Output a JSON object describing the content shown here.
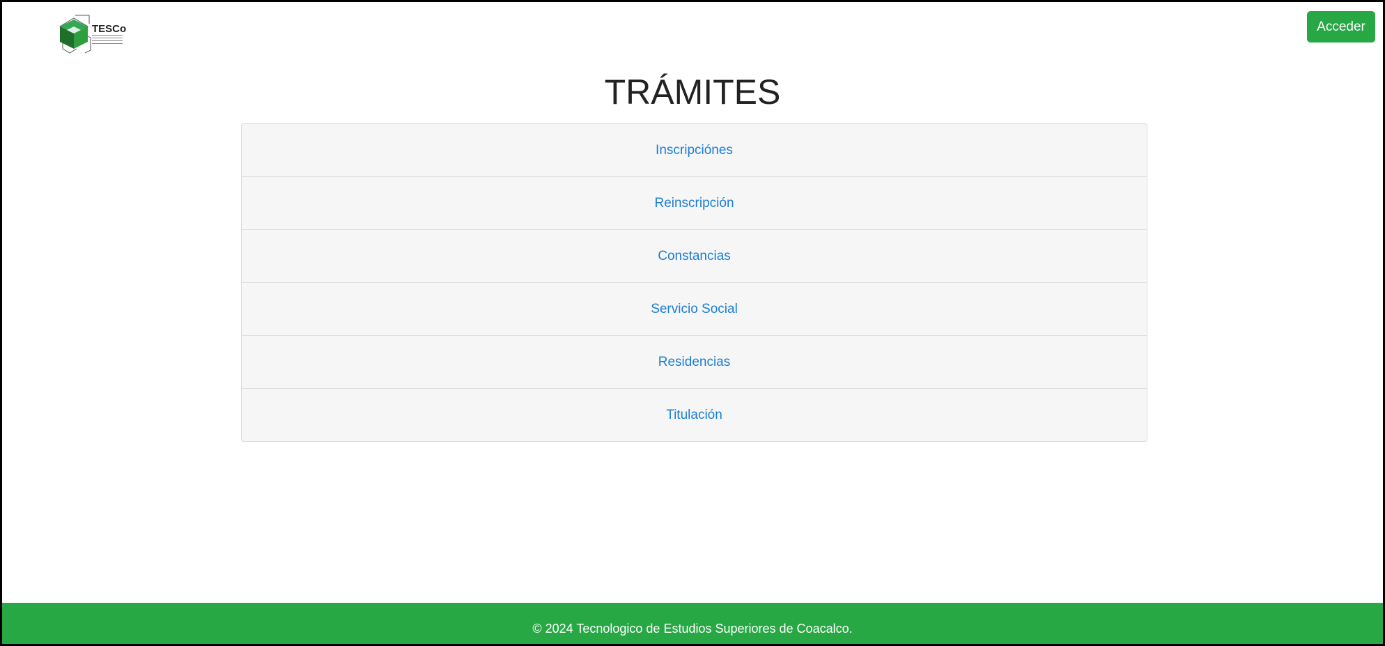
{
  "header": {
    "logo": {
      "icon": "tesco-logo",
      "wordmark": "TESCo",
      "tagline_lines": [
        "TECNOLOGICO",
        "DE ESTUDIOS",
        "SUPERIORES",
        "DE COACALCO"
      ],
      "colors": {
        "green": "#2e9e3e",
        "dark_green": "#1f6f2b",
        "outline": "#444444"
      }
    },
    "access_button": {
      "label": "Acceder",
      "color": "#28a745"
    }
  },
  "main": {
    "title": "TRÁMITES",
    "items": [
      {
        "label": "Inscripciónes"
      },
      {
        "label": "Reinscripción"
      },
      {
        "label": "Constancias"
      },
      {
        "label": "Servicio Social"
      },
      {
        "label": "Residencias"
      },
      {
        "label": "Titulación"
      }
    ],
    "link_color": "#1b7ed6"
  },
  "footer": {
    "text": "© 2024 Tecnologico de Estudios Superiores de Coacalco.",
    "color": "#28a745"
  }
}
